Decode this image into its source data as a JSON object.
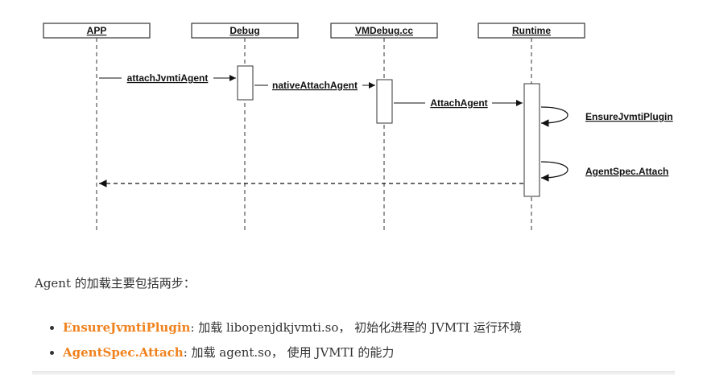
{
  "diagram": {
    "participants": [
      "APP",
      "Debug",
      "VMDebug.cc",
      "Runtime"
    ],
    "messages": {
      "attach_jvmti_agent": "attachJvmtiAgent",
      "native_attach_agent": "nativeAttachAgent",
      "attach_agent": "AttachAgent",
      "ensure_jvmti_plugin": "EnsureJvmtiPlugin",
      "agent_spec_attach": "AgentSpec.Attach"
    }
  },
  "intro": "Agent 的加载主要包括两步：",
  "steps": [
    {
      "keyword": "EnsureJvmtiPlugin",
      "text": ": 加载 libopenjdkjvmti.so，  初始化进程的 JVMTI 运行环境"
    },
    {
      "keyword": "AgentSpec.Attach",
      "text": ": 加载 agent.so，  使用 JVMTI 的能力"
    }
  ],
  "colors": {
    "keyword": "#f0821e",
    "line": "#222222"
  }
}
